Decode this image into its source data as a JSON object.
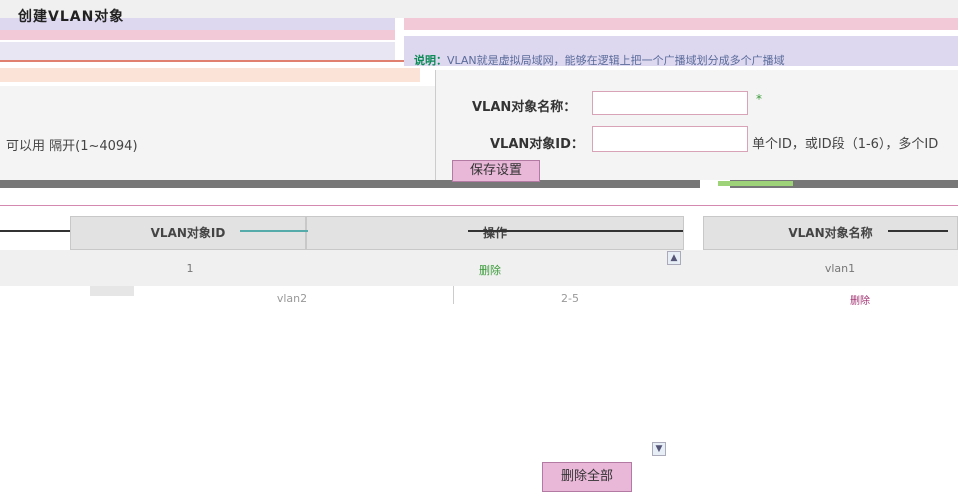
{
  "header": {
    "title": "创建VLAN对象"
  },
  "note": {
    "label": "说明：",
    "text": "VLAN就是虚拟局域网，能够在逻辑上把一个广播域划分成多个广播域"
  },
  "left": {
    "hint": "可以用 隔开(1~4094)"
  },
  "form": {
    "name_label": "VLAN对象名称：",
    "name_value": "",
    "id_label": "VLAN对象ID：",
    "id_value": "",
    "id_hint": "单个ID，或ID段（1-6），多个ID",
    "required_mark": "*",
    "save_label": "保存设置"
  },
  "table": {
    "columns": [
      "VLAN对象ID",
      "操作",
      "VLAN对象名称"
    ],
    "rows": [
      {
        "id": "1",
        "action": "删除",
        "name": "vlan1"
      },
      {
        "id": "",
        "action": "删除",
        "name": "vlan2"
      }
    ],
    "partial": {
      "left": "vlan2",
      "mid": "2-5"
    }
  },
  "footer": {
    "delete_all_label": "删除全部"
  },
  "colors": {
    "pink_strip": "#f2c9d6",
    "lavender": "#ddd8f0",
    "dark_bar": "#777777",
    "accent_green": "#0a8a55",
    "button_pink": "#e9b7d8"
  }
}
